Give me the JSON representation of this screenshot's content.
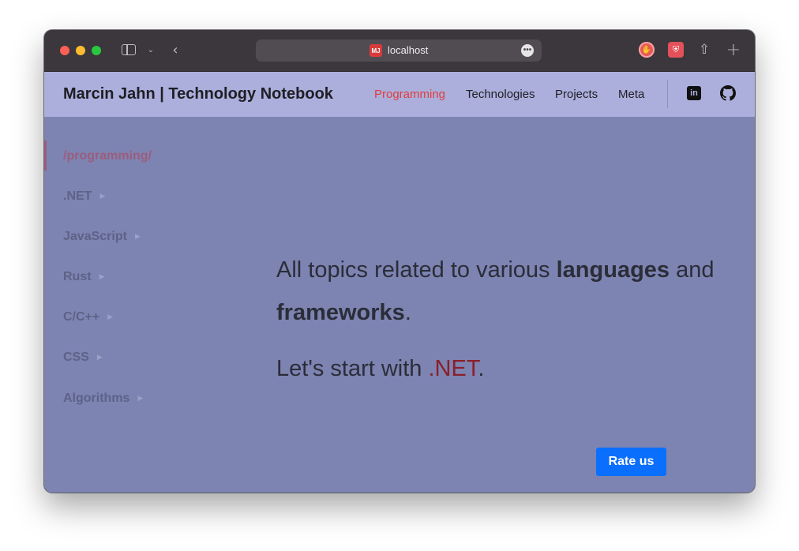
{
  "browser": {
    "url_text": "localhost",
    "favicon_text": "MJ",
    "more_glyph": "•••"
  },
  "site": {
    "brand": "Marcin Jahn | Technology Notebook",
    "nav": [
      {
        "label": "Programming",
        "active": true
      },
      {
        "label": "Technologies"
      },
      {
        "label": "Projects"
      },
      {
        "label": "Meta"
      }
    ],
    "accent_color": "#e03c3c"
  },
  "sidebar": {
    "heading": "/programming/",
    "items": [
      {
        "label": ".NET"
      },
      {
        "label": "JavaScript"
      },
      {
        "label": "Rust"
      },
      {
        "label": "C/C++"
      },
      {
        "label": "CSS"
      },
      {
        "label": "Algorithms"
      }
    ]
  },
  "hero": {
    "part1": "All topics related to various ",
    "bold1": "languages",
    "part2": " and ",
    "bold2": "frameworks",
    "part3": ".",
    "line2_prefix": "Let's start with ",
    "line2_link": ".NET",
    "line2_suffix": "."
  },
  "rate_button": {
    "label": "Rate us",
    "color": "#0a6ffd"
  },
  "icons": {
    "sidebar_toggle": "sidebar-toggle-icon",
    "back": "chevron-left-icon",
    "share": "share-icon",
    "new_tab": "plus-icon",
    "linkedin": "linkedin-icon",
    "github": "github-icon"
  }
}
